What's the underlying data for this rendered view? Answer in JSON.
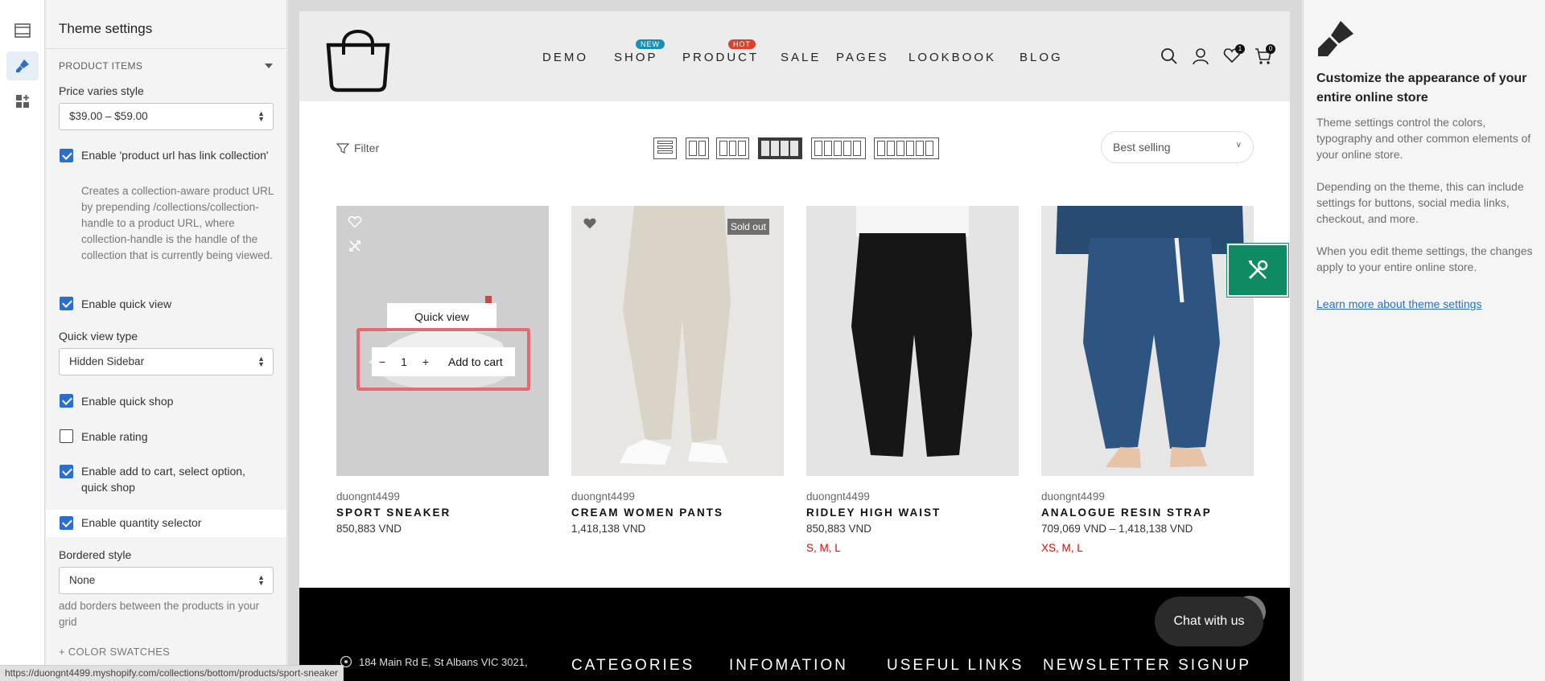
{
  "left_panel": {
    "title": "Theme settings",
    "section": "PRODUCT ITEMS",
    "price_style_label": "Price varies style",
    "price_style_value": "$39.00 – $59.00",
    "product_url_label": "Enable 'product url has link collection'",
    "product_url_help": "Creates a collection-aware product URL by prepending /collections/collection-handle to a product URL, where collection-handle is the handle of the collection that is currently being viewed.",
    "quick_view_label": "Enable quick view",
    "quick_view_type_label": "Quick view type",
    "quick_view_type_value": "Hidden Sidebar",
    "quick_shop_label": "Enable quick shop",
    "rating_label": "Enable rating",
    "add_to_cart_label": "Enable add to cart, select option, quick shop",
    "qty_selector_label": "Enable quantity selector",
    "bordered_label": "Bordered style",
    "bordered_value": "None",
    "bordered_help": "add borders between the products in your grid",
    "color_swatches": "+ COLOR SWATCHES"
  },
  "store": {
    "nav": [
      "DEMO",
      "SHOP",
      "PRODUCT",
      "SALE",
      "PAGES",
      "LOOKBOOK",
      "BLOG"
    ],
    "badge_new": "NEW",
    "badge_hot": "HOT",
    "badge_new_color": "#1a8fb5",
    "badge_hot_color": "#d8422f",
    "wishlist_count": "1",
    "cart_count": "0",
    "filter_label": "Filter",
    "sort_value": "Best selling",
    "quick_view": "Quick view",
    "qty_minus": "−",
    "qty_value": "1",
    "qty_plus": "+",
    "add_to_cart": "Add to cart",
    "sold_out": "Sold out",
    "products": [
      {
        "vendor": "duongnt4499",
        "name": "SPORT SNEAKER",
        "price": "850,883 VND",
        "sizes": ""
      },
      {
        "vendor": "duongnt4499",
        "name": "CREAM WOMEN PANTS",
        "price": "1,418,138 VND",
        "sizes": ""
      },
      {
        "vendor": "duongnt4499",
        "name": "RIDLEY HIGH WAIST",
        "price": "850,883 VND",
        "sizes": "S, M, L"
      },
      {
        "vendor": "duongnt4499",
        "name": "ANALOGUE RESIN STRAP",
        "price": "709,069 VND – 1,418,138 VND",
        "sizes": "XS, M, L"
      }
    ],
    "chat": "Chat with us",
    "footer_address": "184 Main Rd E, St Albans VIC 3021,",
    "footer_cols": [
      "CATEGORIES",
      "INFOMATION",
      "USEFUL LINKS",
      "NEWSLETTER SIGNUP"
    ]
  },
  "right_panel": {
    "heading": "Customize the appearance of your entire online store",
    "p1": "Theme settings control the colors, typography and other common elements of your online store.",
    "p2": "Depending on the theme, this can include settings for buttons, social media links, checkout, and more.",
    "p3": "When you edit theme settings, the changes apply to your entire online store.",
    "link": "Learn more about theme settings"
  },
  "status_url": "https://duongnt4499.myshopify.com/collections/bottom/products/sport-sneaker",
  "colors": {
    "accent": "#2c6ecb",
    "highlight": "#e46a6e",
    "float_button": "#0f8b63"
  }
}
